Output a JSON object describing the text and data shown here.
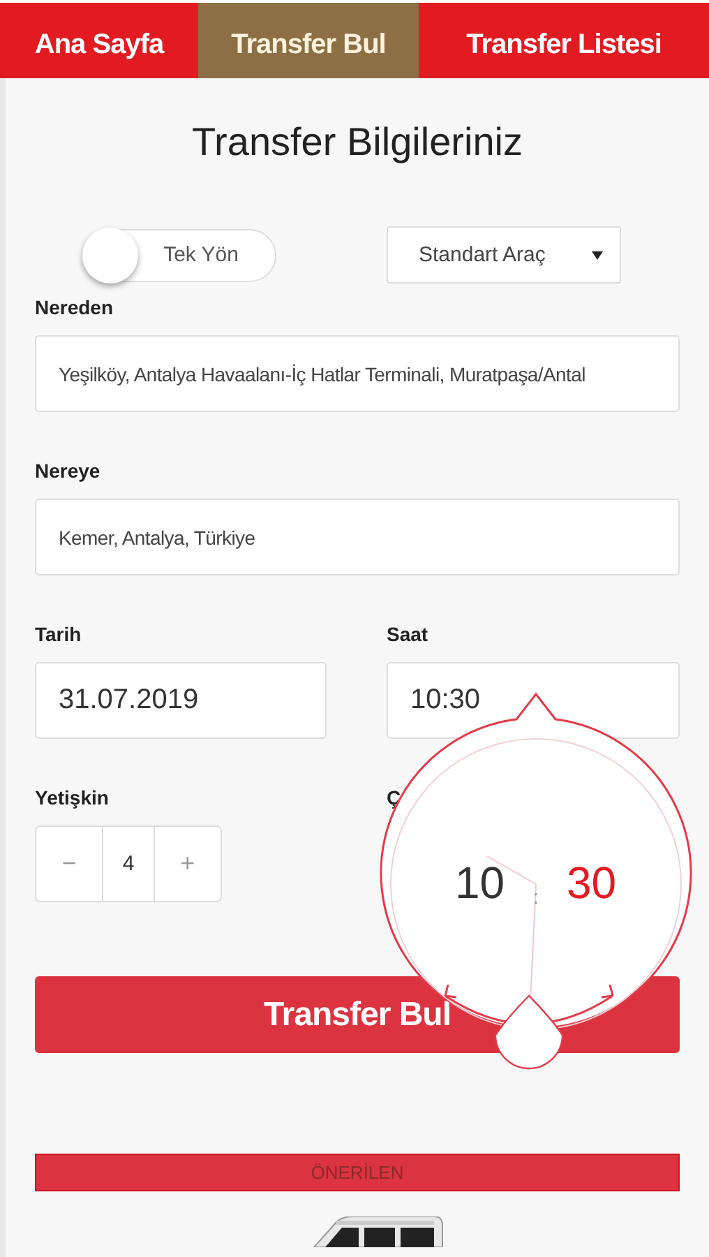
{
  "tabs": [
    {
      "label": "Ana Sayfa",
      "selected": false
    },
    {
      "label": "Transfer Bul",
      "selected": true
    },
    {
      "label": "Transfer Listesi",
      "selected": false
    }
  ],
  "title": "Transfer Bilgileriniz",
  "trip_toggle": {
    "label": "Tek Yön",
    "on": false
  },
  "vehicle_select": {
    "value": "Standart Araç"
  },
  "from": {
    "label": "Nereden",
    "value": "Yeşilköy, Antalya Havaalanı-İç Hatlar Terminali, Muratpaşa/Antal"
  },
  "to": {
    "label": "Nereye",
    "value": "Kemer, Antalya, Türkiye"
  },
  "date": {
    "label": "Tarih",
    "value": "31.07.2019"
  },
  "time": {
    "label": "Saat",
    "value": "10:30"
  },
  "adults": {
    "label": "Yetişkin",
    "decrement": "−",
    "value": "4",
    "increment": "+"
  },
  "children": {
    "label": "Ç"
  },
  "time_picker": {
    "hour": "10",
    "separator": ":",
    "minute": "30"
  },
  "submit_button": "Transfer Bul",
  "recommended_banner": "ÖNERİLEN"
}
